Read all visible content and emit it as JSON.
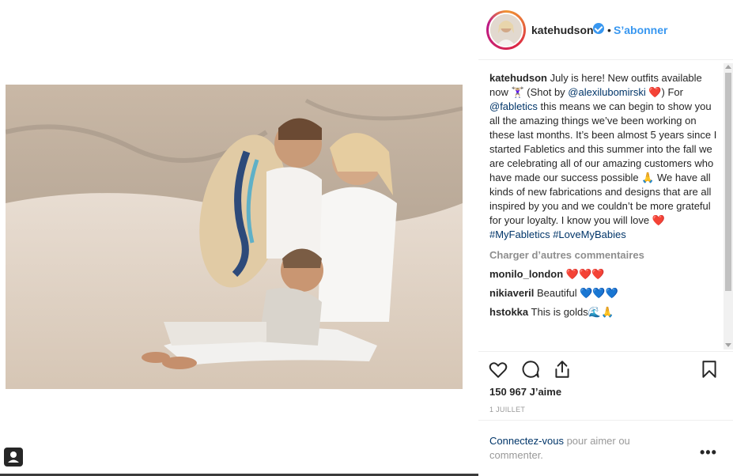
{
  "header": {
    "username": "katehudson",
    "separator": "•",
    "follow_label": "S’abonner"
  },
  "caption": {
    "username": "katehudson",
    "text_1": " July is here! New outfits available now 🏋🏼‍♀️ (Shot by ",
    "mention_1": "@alexilubomirski",
    "text_2": " ❤️) For ",
    "mention_2": "@fabletics",
    "text_3": " this means we can begin to show you all the amazing things we’ve been working on these last months. It’s been almost 5 years since I started Fabletics and this summer into the fall we are celebrating all of our amazing customers who have made our success possible 🙏 We have all kinds of new fabrications and designs that are all inspired by you and we couldn’t be more grateful for your loyalty. I know you will love ❤️ ",
    "hashtag_1": "#MyFabletics",
    "hashtag_2": "#LoveMyBabies"
  },
  "load_more_label": "Charger d’autres commentaires",
  "comments": [
    {
      "username": "monilo_london",
      "text": " ❤️❤️❤️"
    },
    {
      "username": "nikiaveril",
      "text": " Beautiful 💙💙💙"
    },
    {
      "username": "hstokka",
      "text": " This is golds🌊🙏"
    }
  ],
  "likes_label": "150 967 J’aime",
  "date_label": "1 JUILLET",
  "login": {
    "link_label": "Connectez-vous",
    "rest_label": " pour aimer ou commenter."
  },
  "more_label": "•••",
  "icons": {
    "like": "heart-icon",
    "comment": "comment-icon",
    "share": "share-icon",
    "save": "bookmark-icon",
    "user_tag": "user-tag-icon",
    "verified": "verified-badge-icon"
  },
  "colors": {
    "accent": "#3897f0",
    "text": "#262626",
    "muted": "#8e8e8e",
    "link": "#003569"
  }
}
